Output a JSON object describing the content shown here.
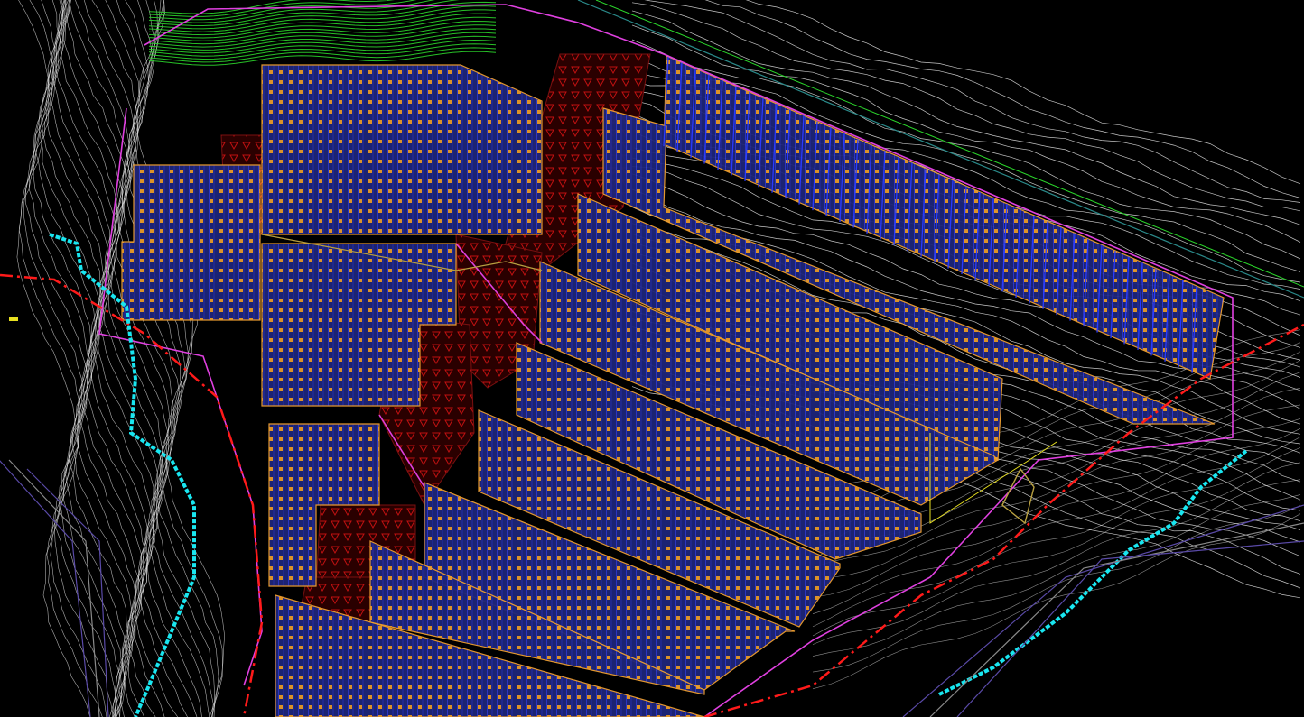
{
  "canvas": {
    "background": "#000000",
    "description_visible_text": ""
  },
  "colors": {
    "contour_white": "#e8e8e8",
    "contour_green": "#2bd62b",
    "pv_blue": "#2a3cff",
    "pv_panel_fill": "#232a8a",
    "pv_orange": "#f0a030",
    "boundary_magenta": "#e040e0",
    "dash_red": "#ff1a1a",
    "road_cyan": "#19e6f0",
    "fill_darkred": "#3a0000",
    "cable_olive": "#b8a040",
    "teal_line": "#2a8a8a",
    "purple_line": "#5a4aa8",
    "gray_line": "#8a8a8a"
  },
  "layers": {
    "contours": "contour-lines",
    "pv_arrays": "pv-array-blocks",
    "site_boundary": "site-boundary",
    "redline": "red-dashed-boundary",
    "road": "cyan-road",
    "excluded_zones": "excluded-zone-fill"
  }
}
